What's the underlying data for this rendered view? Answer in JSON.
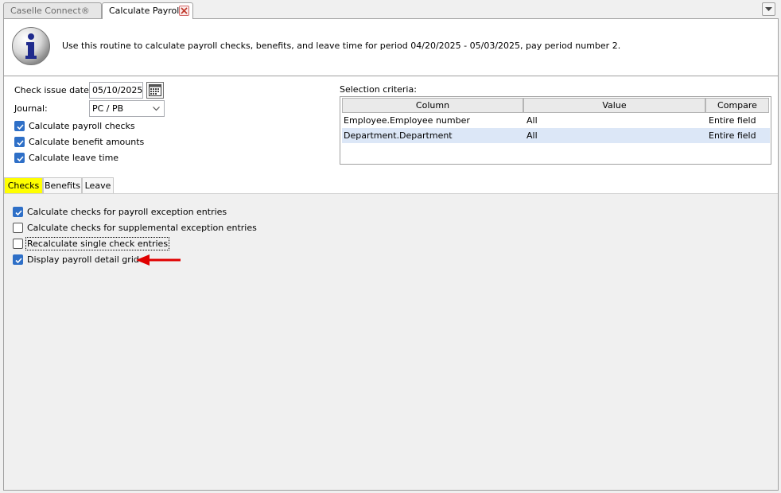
{
  "tabs": {
    "home": "Caselle Connect®",
    "active": "Calculate Payroll"
  },
  "info": {
    "message": "Use this routine to calculate payroll checks, benefits, and leave time for period 04/20/2025 - 05/03/2025, pay period number 2."
  },
  "form": {
    "check_issue_date_label": "Check issue date:",
    "check_issue_date_value": "05/10/2025",
    "journal_label": "Journal:",
    "journal_value": "PC / PB",
    "options": [
      {
        "label": "Calculate payroll checks",
        "checked": true
      },
      {
        "label": "Calculate benefit amounts",
        "checked": true
      },
      {
        "label": "Calculate leave time",
        "checked": true
      }
    ]
  },
  "selection": {
    "label": "Selection criteria:",
    "columns": [
      "Column",
      "Value",
      "Compare"
    ],
    "rows": [
      {
        "column": "Employee.Employee number",
        "value": "All",
        "compare": "Entire field",
        "selected": false
      },
      {
        "column": "Department.Department",
        "value": "All",
        "compare": "Entire field",
        "selected": true
      }
    ]
  },
  "section_tabs": [
    "Checks",
    "Benefits",
    "Leave"
  ],
  "active_section": "Checks",
  "checks": [
    {
      "label": "Calculate checks for payroll exception entries",
      "checked": true
    },
    {
      "label": "Calculate checks for supplemental exception entries",
      "checked": false
    },
    {
      "label": "Recalculate single check entries",
      "checked": false
    },
    {
      "label": "Display payroll detail grid",
      "checked": true
    }
  ],
  "colors": {
    "active_tab_highlight": "#ffff00",
    "checkbox_checked": "#2e6fc7",
    "annotation_arrow": "#e00000",
    "selected_row": "#dce7f7"
  },
  "icons": {
    "info": "info-icon",
    "close": "close-icon",
    "menu": "chevron-down-icon",
    "calendar": "calendar-icon"
  }
}
